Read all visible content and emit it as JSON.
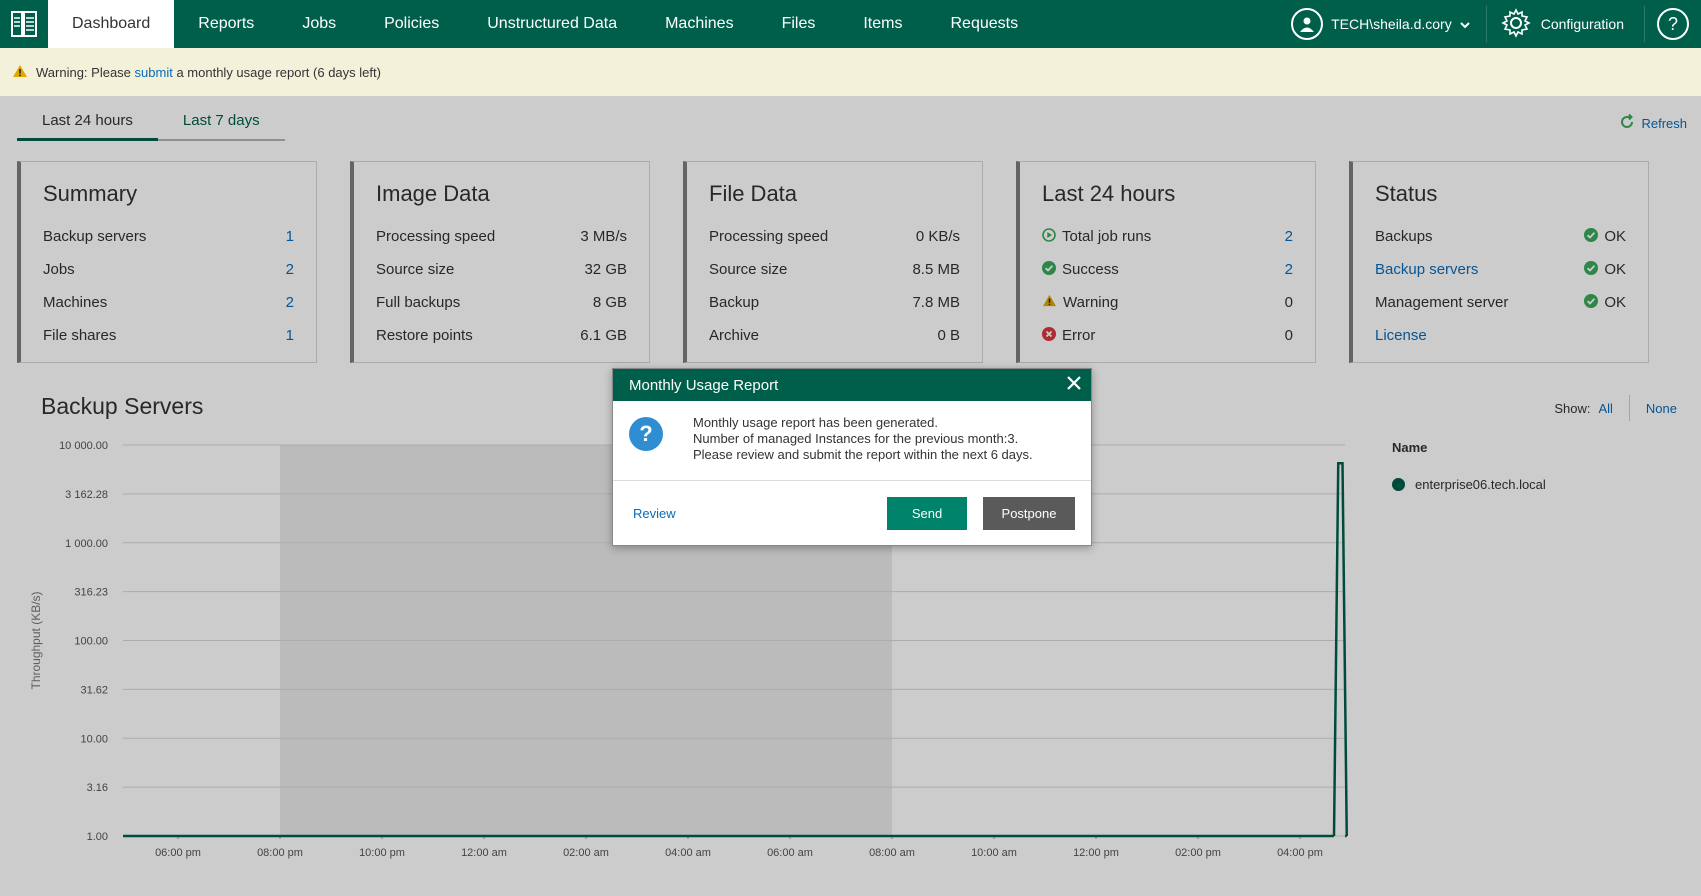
{
  "nav": {
    "tabs": [
      "Dashboard",
      "Reports",
      "Jobs",
      "Policies",
      "Unstructured Data",
      "Machines",
      "Files",
      "Items",
      "Requests"
    ],
    "user": "TECH\\sheila.d.cory",
    "configuration": "Configuration",
    "help": "?"
  },
  "warning": {
    "prefix": "Warning: Please",
    "link": "submit",
    "suffix": "a monthly usage report (6 days left)"
  },
  "period": {
    "tab1": "Last 24 hours",
    "tab2": "Last 7 days",
    "refresh": "Refresh"
  },
  "summary": {
    "title": "Summary",
    "rows": [
      {
        "label": "Backup servers",
        "value": "1"
      },
      {
        "label": "Jobs",
        "value": "2"
      },
      {
        "label": "Machines",
        "value": "2"
      },
      {
        "label": "File shares",
        "value": "1"
      }
    ]
  },
  "image_data": {
    "title": "Image Data",
    "rows": [
      {
        "label": "Processing speed",
        "value": "3 MB/s"
      },
      {
        "label": "Source size",
        "value": "32 GB"
      },
      {
        "label": "Full backups",
        "value": "8 GB"
      },
      {
        "label": "Restore points",
        "value": "6.1 GB"
      }
    ]
  },
  "file_data": {
    "title": "File Data",
    "rows": [
      {
        "label": "Processing speed",
        "value": "0 KB/s"
      },
      {
        "label": "Source size",
        "value": "8.5 MB"
      },
      {
        "label": "Backup",
        "value": "7.8 MB"
      },
      {
        "label": "Archive",
        "value": "0 B"
      }
    ]
  },
  "last24": {
    "title": "Last 24 hours",
    "rows": [
      {
        "label": "Total job runs",
        "value": "2"
      },
      {
        "label": "Success",
        "value": "2"
      },
      {
        "label": "Warning",
        "value": "0"
      },
      {
        "label": "Error",
        "value": "0"
      }
    ]
  },
  "status": {
    "title": "Status",
    "rows": [
      {
        "label": "Backups",
        "value": "OK"
      },
      {
        "label": "Backup servers",
        "value": "OK"
      },
      {
        "label": "Management server",
        "value": "OK"
      },
      {
        "label": "License",
        "value": ""
      }
    ]
  },
  "backup_servers": {
    "title": "Backup Servers",
    "show_label": "Show:",
    "show_all": "All",
    "show_none": "None",
    "legend_title": "Name",
    "legend_item": "enterprise06.tech.local"
  },
  "chart_data": {
    "type": "line",
    "ylabel": "Throughput (KB/s)",
    "y_ticks": [
      "10 000.00",
      "3 162.28",
      "1 000.00",
      "316.23",
      "100.00",
      "31.62",
      "10.00",
      "3.16",
      "1.00"
    ],
    "x_ticks": [
      "06:00 pm",
      "08:00 pm",
      "10:00 pm",
      "12:00 am",
      "02:00 am",
      "04:00 am",
      "06:00 am",
      "08:00 am",
      "10:00 am",
      "12:00 pm",
      "02:00 pm",
      "04:00 pm"
    ],
    "scale": "log",
    "ylim": [
      1,
      10000
    ],
    "series": [
      {
        "name": "enterprise06.tech.local",
        "color": "#005f4b",
        "x": [
          "04:40 pm",
          "04:45 pm",
          "04:50 pm",
          "04:55 pm"
        ],
        "values": [
          1,
          6500,
          6500,
          1
        ]
      }
    ],
    "highlight_range": [
      "08:00 pm",
      "08:00 am"
    ]
  },
  "modal": {
    "title": "Monthly Usage Report",
    "line1": "Monthly usage report has been generated.",
    "line2": "Number of managed Instances for the previous month:3.",
    "line3": "Please review and submit the report within the next 6 days.",
    "review": "Review",
    "send": "Send",
    "postpone": "Postpone"
  }
}
